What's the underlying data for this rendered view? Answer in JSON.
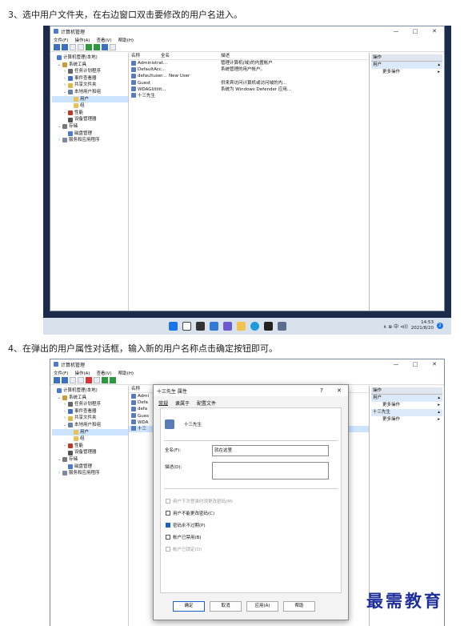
{
  "step3": "3、选中用户文件夹，在右边窗口双击要修改的用户名进入。",
  "step4": "4、在弹出的用户属性对话框，输入新的用户名称点击确定按钮即可。",
  "window": {
    "title": "计算机管理",
    "controls": [
      "—",
      "□",
      "✕"
    ],
    "menu": [
      "文件(F)",
      "操作(A)",
      "查看(V)",
      "帮助(H)"
    ]
  },
  "tree": [
    {
      "label": "计算机管理(本地)",
      "indent": 0,
      "tw": "",
      "color": "#4a7bd0"
    },
    {
      "label": "系统工具",
      "indent": 1,
      "tw": "⌄",
      "color": "#c79a3b"
    },
    {
      "label": "任务计划程序",
      "indent": 2,
      "tw": "›",
      "color": "#666"
    },
    {
      "label": "事件查看器",
      "indent": 2,
      "tw": "›",
      "color": "#3b70c4"
    },
    {
      "label": "共享文件夹",
      "indent": 2,
      "tw": "›",
      "color": "#e0b84a"
    },
    {
      "label": "本地用户和组",
      "indent": 2,
      "tw": "⌄",
      "color": "#6a7fa8"
    },
    {
      "label": "用户",
      "indent": 3,
      "tw": "",
      "color": "#e8c15a",
      "selected": true
    },
    {
      "label": "组",
      "indent": 3,
      "tw": "",
      "color": "#e8c15a"
    },
    {
      "label": "性能",
      "indent": 2,
      "tw": "›",
      "color": "#c0392b"
    },
    {
      "label": "设备管理器",
      "indent": 2,
      "tw": "",
      "color": "#555"
    },
    {
      "label": "存储",
      "indent": 1,
      "tw": "⌄",
      "color": "#777"
    },
    {
      "label": "磁盘管理",
      "indent": 2,
      "tw": "",
      "color": "#4a7bd0"
    },
    {
      "label": "服务和应用程序",
      "indent": 1,
      "tw": "›",
      "color": "#7a8aa0"
    }
  ],
  "list": {
    "headers": [
      "名称",
      "全名",
      "描述"
    ],
    "rows": [
      {
        "name": "Administrat...",
        "full": "",
        "desc": "管理计算机(域)的内置帐户"
      },
      {
        "name": "DefaultAcc...",
        "full": "",
        "desc": "系统管理的用户帐户。"
      },
      {
        "name": "defaultuser...",
        "full": "New User",
        "desc": ""
      },
      {
        "name": "Guest",
        "full": "",
        "desc": "供来宾访问计算机或访问域的内..."
      },
      {
        "name": "WDAGUtilit...",
        "full": "",
        "desc": "系统为 Windows Defender 应用..."
      },
      {
        "name": "十三先生",
        "full": "",
        "desc": ""
      }
    ]
  },
  "list2": {
    "rows": [
      "Admi",
      "Defa",
      "defa",
      "Gues",
      "WDA",
      "十三"
    ]
  },
  "actions": {
    "header": "操作",
    "section1": "用户",
    "section2": "十三先生",
    "more": "更多操作"
  },
  "taskbar": {
    "tray": "∧  ⊕  中  ⊲))",
    "time": "14:53",
    "date": "2021/8/20",
    "badge": "2"
  },
  "dialog": {
    "title": "十三先生 属性",
    "help": "?",
    "close": "✕",
    "tabs": [
      "常规",
      "隶属于",
      "配置文件"
    ],
    "username": "十三先生",
    "fullname_label": "全名(F):",
    "fullname_value": "就在这里",
    "desc_label": "描述(D):",
    "checks": [
      {
        "label": "用户下次登录时须更改密码(M)",
        "checked": false,
        "disabled": true
      },
      {
        "label": "用户不能更改密码(C)",
        "checked": false,
        "disabled": false
      },
      {
        "label": "密码永不过期(P)",
        "checked": true,
        "disabled": false
      },
      {
        "label": "帐户已禁用(B)",
        "checked": false,
        "disabled": false
      },
      {
        "label": "帐户已锁定(O)",
        "checked": false,
        "disabled": true
      }
    ],
    "buttons": [
      "确定",
      "取消",
      "应用(A)",
      "帮助"
    ]
  },
  "watermark": "最需教育"
}
